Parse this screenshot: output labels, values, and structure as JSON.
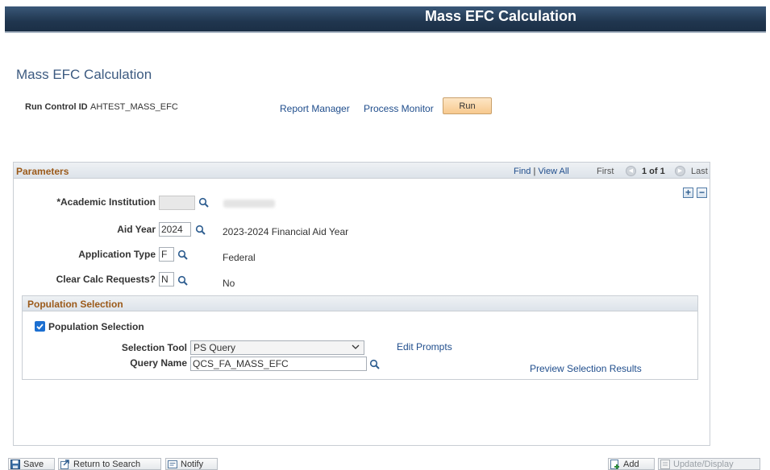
{
  "banner": {
    "title": "Mass EFC Calculation"
  },
  "page": {
    "title": "Mass EFC Calculation",
    "run_control_label": "Run Control ID",
    "run_control_value": "AHTEST_MASS_EFC",
    "report_manager": "Report Manager",
    "process_monitor": "Process Monitor",
    "run_button": "Run"
  },
  "parameters": {
    "title": "Parameters",
    "find": "Find",
    "view_all": "View All",
    "first": "First",
    "count": "1 of 1",
    "last": "Last",
    "fields": {
      "institution_label": "*Academic Institution",
      "aid_year_label": "Aid Year",
      "aid_year_value": "2024",
      "aid_year_desc": "2023-2024 Financial Aid Year",
      "app_type_label": "Application Type",
      "app_type_value": "F",
      "app_type_desc": "Federal",
      "clear_calc_label": "Clear Calc Requests?",
      "clear_calc_value": "N",
      "clear_calc_desc": "No"
    }
  },
  "population": {
    "title": "Population Selection",
    "checkbox_label": "Population Selection",
    "checked": true,
    "selection_tool_label": "Selection Tool",
    "selection_tool_value": "PS Query",
    "edit_prompts": "Edit Prompts",
    "query_name_label": "Query Name",
    "query_name_value": "QCS_FA_MASS_EFC",
    "preview_results": "Preview Selection Results"
  },
  "footer": {
    "save": "Save",
    "return_to_search": "Return to Search",
    "notify": "Notify",
    "add": "Add",
    "update_display": "Update/Display"
  },
  "colors": {
    "accent": "#1f4d8c",
    "section_title": "#9b5a1a",
    "banner": "#20364f"
  }
}
